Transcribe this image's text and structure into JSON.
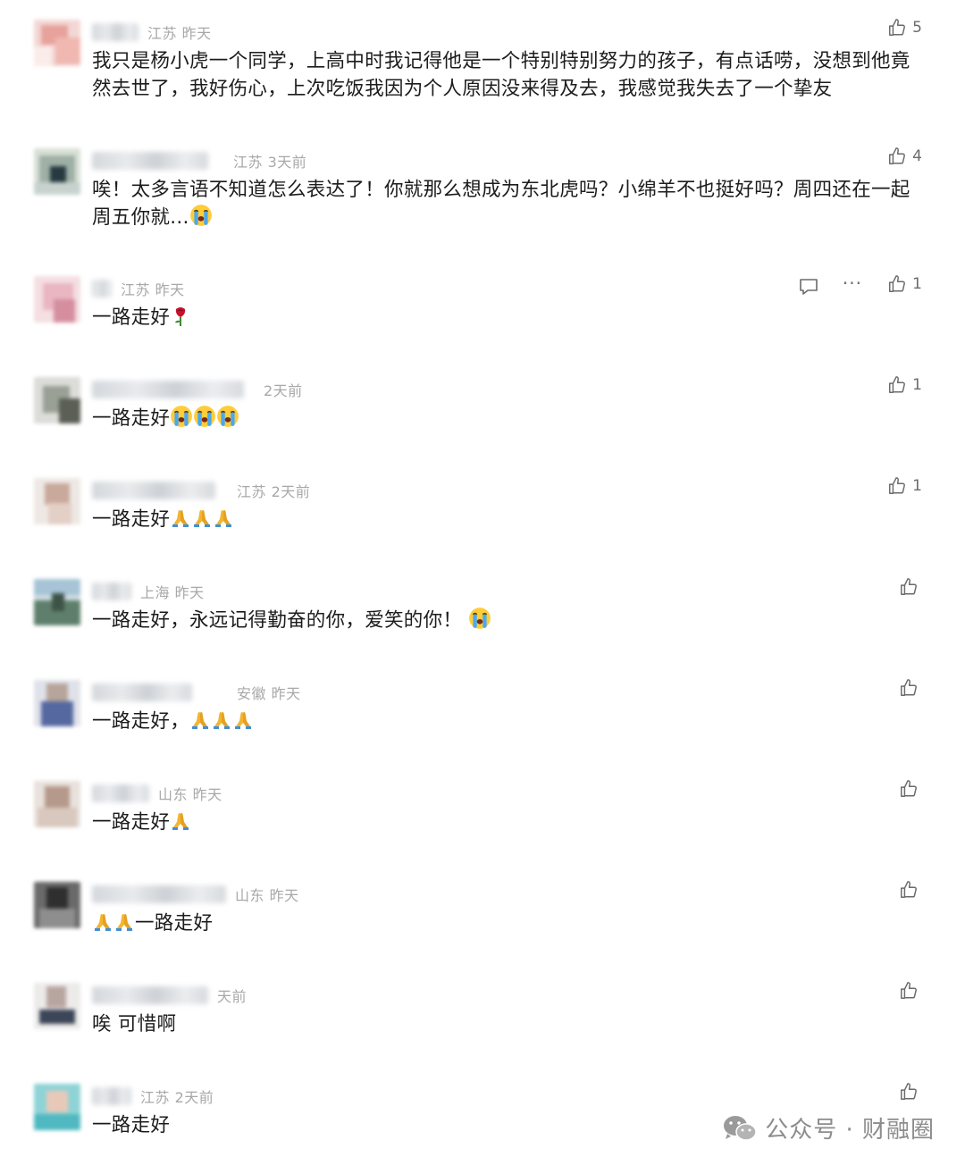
{
  "comments": [
    {
      "location": "江苏",
      "time": "昨天",
      "text": "我只是杨小虎一个同学，上高中时我记得他是一个特别特别努力的孩子，有点话唠，没想到他竟然去世了，我好伤心，上次吃饭我因为个人原因没来得及去，我感觉我失去了一个挚友",
      "likes": "5"
    },
    {
      "location": "江苏",
      "time": "3天前",
      "text": "唉！太多言语不知道怎么表达了！你就那么想成为东北虎吗？小绵羊不也挺好吗？周四还在一起周五你就...",
      "likes": "4"
    },
    {
      "location": "江苏",
      "time": "昨天",
      "text": "一路走好",
      "likes": "1"
    },
    {
      "location": "",
      "time": "2天前",
      "text": "一路走好",
      "likes": "1"
    },
    {
      "location": "江苏",
      "time": "2天前",
      "text": "一路走好",
      "likes": "1"
    },
    {
      "location": "上海",
      "time": "昨天",
      "text": "一路走好，永远记得勤奋的你，爱笑的你！",
      "likes": ""
    },
    {
      "location": "安徽",
      "time": "昨天",
      "text": "一路走好，",
      "likes": ""
    },
    {
      "location": "山东",
      "time": "昨天",
      "text": "一路走好",
      "likes": ""
    },
    {
      "location": "山东",
      "time": "昨天",
      "text": "一路走好",
      "likes": ""
    },
    {
      "location": "",
      "time": "天前",
      "text": "唉 可惜啊",
      "likes": ""
    },
    {
      "location": "江苏",
      "time": "2天前",
      "text": "一路走好",
      "likes": ""
    }
  ],
  "watermark": {
    "label": "公众号 · 财融圈"
  },
  "icons": {
    "like": "thumbs-up-icon",
    "reply": "comment-icon",
    "more": "more-icon",
    "crying": "crying-face-emoji",
    "pray": "folded-hands-emoji",
    "rose": "wilted-rose-emoji",
    "wechat": "wechat-icon"
  }
}
